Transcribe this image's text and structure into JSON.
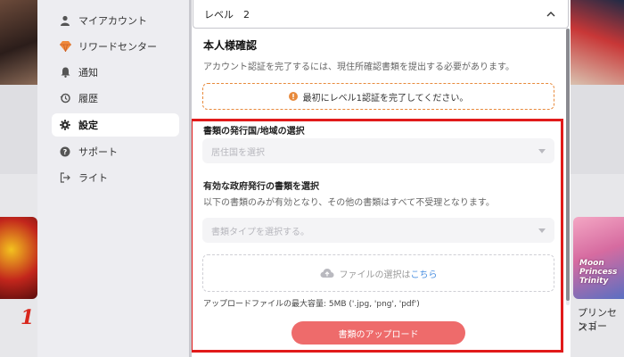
{
  "sidebar": {
    "items": [
      {
        "label": "マイアカウント",
        "icon": "person-icon",
        "active": false
      },
      {
        "label": "リワードセンター",
        "icon": "diamond-icon",
        "active": false
      },
      {
        "label": "通知",
        "icon": "bell-icon",
        "active": false
      },
      {
        "label": "履歴",
        "icon": "history-icon",
        "active": false
      },
      {
        "label": "設定",
        "icon": "gear-icon",
        "active": true
      },
      {
        "label": "サポート",
        "icon": "help-icon",
        "active": false
      },
      {
        "label": "ライト",
        "icon": "logout-icon",
        "active": false
      }
    ]
  },
  "level_select": {
    "value": "レベル　2"
  },
  "verification": {
    "title": "本人様確認",
    "description": "アカウント認証を完了するには、現住所確認書類を提出する必要があります。",
    "warning": "最初にレベル1認証を完了してください。"
  },
  "country_section": {
    "label": "書類の発行国/地域の選択",
    "placeholder": "居住国を選択"
  },
  "document_section": {
    "label": "有効な政府発行の書類を選択",
    "description": "以下の書類のみが有効となり、その他の書類はすべて不受理となります。",
    "placeholder": "書類タイプを選択する。"
  },
  "file_upload": {
    "text": "ファイルの選択は",
    "link": "こちら",
    "hint": "アップロードファイルの最大容量: 5MB ('.jpg, 'png', 'pdf')"
  },
  "upload_button": {
    "label": "書類のアップロード"
  },
  "background": {
    "left_rank": "1",
    "right_card_title": "Moon Princess Trinity",
    "right_caption_1": "プリンセスト",
    "right_caption_2": "ンゴー"
  },
  "colors": {
    "highlight_border": "#e11a1a",
    "warning_border": "#e88a3c",
    "primary_button": "#ee6b6b",
    "link": "#4a8fe0"
  }
}
